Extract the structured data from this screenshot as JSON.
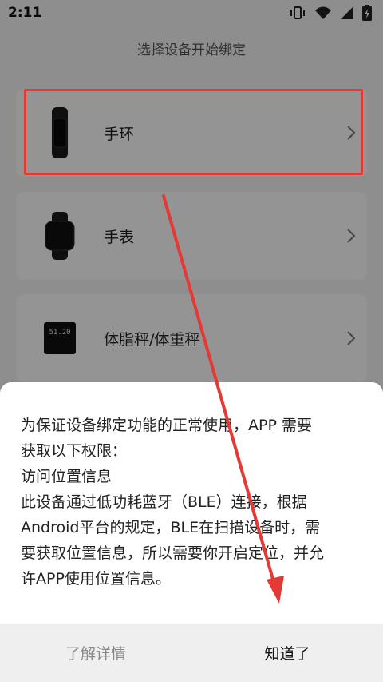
{
  "status_bar": {
    "time": "2:11",
    "icons": [
      "vibrate-icon",
      "wifi-icon",
      "signal-icon",
      "battery-charging-icon"
    ]
  },
  "page": {
    "title": "选择设备开始绑定"
  },
  "devices": [
    {
      "label": "手环",
      "icon": "band-icon"
    },
    {
      "label": "手表",
      "icon": "watch-icon"
    },
    {
      "label": "体脂秤/体重秤",
      "icon": "scale-icon",
      "screen_text": "51.20"
    }
  ],
  "dialog": {
    "lines": [
      "为保证设备绑定功能的正常使用，APP 需要",
      "获取以下权限：",
      "访问位置信息",
      "此设备通过低功耗蓝牙（BLE）连接，根据",
      "Android平台的规定，BLE在扫描设备时，需",
      "要获取位置信息，所以需要你开启定位，并允",
      "许APP使用位置信息。"
    ],
    "secondary_button": "了解详情",
    "primary_button": "知道了"
  },
  "colors": {
    "annotation_red": "#e53935",
    "background": "#f5f5f5",
    "card": "#ffffff"
  }
}
